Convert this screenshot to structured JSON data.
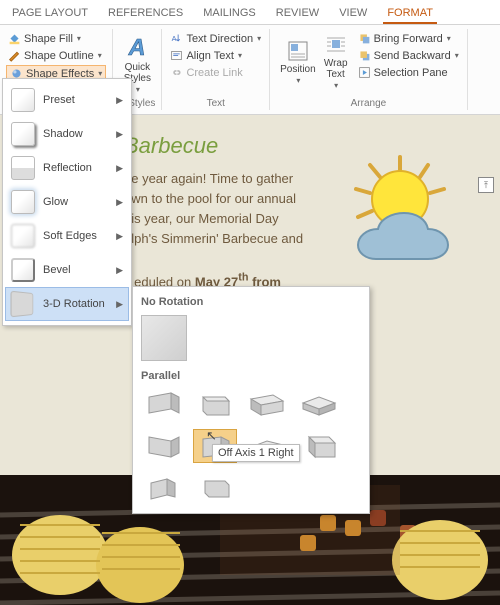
{
  "tabs": {
    "page": "PAGE LAYOUT",
    "ref": "REFERENCES",
    "mail": "MAILINGS",
    "rev": "REVIEW",
    "view": "VIEW",
    "fmt": "FORMAT"
  },
  "ribbon": {
    "shapeFill": "Shape Fill",
    "shapeOutline": "Shape Outline",
    "shapeEffects": "Shape Effects",
    "quickStyles": "Quick\nStyles",
    "wordartGroup": "rt Styles",
    "textDir": "Text Direction",
    "alignText": "Align Text",
    "createLink": "Create Link",
    "textGroup": "Text",
    "position": "Position",
    "wrapText": "Wrap\nText",
    "bringFwd": "Bring Forward",
    "sendBack": "Send Backward",
    "selPane": "Selection Pane",
    "arrangeGroup": "Arrange"
  },
  "menu": {
    "preset": "Preset",
    "shadow": "Shadow",
    "reflection": "Reflection",
    "glow": "Glow",
    "softEdges": "Soft Edges",
    "bevel": "Bevel",
    "rot3d": "3-D Rotation"
  },
  "submenu": {
    "noRot": "No Rotation",
    "parallel": "Parallel"
  },
  "tooltip": "Off Axis 1 Right",
  "doc": {
    "title": "Barbecue",
    "l1": "ne year again! Time to gather",
    "l2": "own to the pool for our annual",
    "l3": "his year, our Memorial Day",
    "l4": "alph's Simmerin' Barbecue and",
    "l5": "eduled on",
    "b1": "May 27",
    "sup": "th",
    "b2": " from"
  }
}
